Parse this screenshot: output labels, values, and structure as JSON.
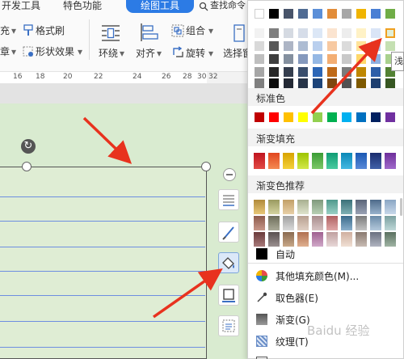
{
  "ribbon": {
    "tabs": [
      "开发工具",
      "特色功能"
    ],
    "active_tab": "绘图工具",
    "search_placeholder": "查找命令",
    "row1": {
      "fill_fragment": "充",
      "format_painter": "格式刷"
    },
    "row2": {
      "fragment": "章",
      "shape_effects": "形状效果"
    },
    "wrap": "环绕",
    "align": "对齐",
    "group": "组合",
    "rotate": "旋转",
    "select_fragment": "选择窗"
  },
  "ruler": {
    "ticks": [
      "16",
      "18",
      "20",
      "22",
      "24",
      "26",
      "28",
      "30",
      "32"
    ]
  },
  "canvas": {
    "rotate_symbol": "↻"
  },
  "dropdown": {
    "theme_colors": [
      [
        "#ffffff",
        "#000000",
        "#48546a",
        "#4f6b93",
        "#5b8fd8",
        "#e28d3a",
        "#a7a7a7",
        "#f0b400",
        "#4a7fd4",
        "#70ad47"
      ],
      [
        "#f2f2f2",
        "#7f7f7f",
        "#d5dae2",
        "#d6dde9",
        "#dce7f6",
        "#fbe4d0",
        "#ededed",
        "#fff2c6",
        "#dae5f6",
        "#e1eed6"
      ],
      [
        "#d9d9d9",
        "#595959",
        "#adb5c5",
        "#adbcd3",
        "#b9cfee",
        "#f7c9a1",
        "#dbdbdb",
        "#ffe49a",
        "#b5cbec",
        "#c5e0b2"
      ],
      [
        "#bfbfbf",
        "#3f3f3f",
        "#84909f",
        "#8599bd",
        "#95b8e4",
        "#f3ae73",
        "#c9c9c9",
        "#ffd86a",
        "#8fb1e2",
        "#a9d18e"
      ],
      [
        "#a6a6a6",
        "#262626",
        "#353e4e",
        "#3a4e6d",
        "#2c66b6",
        "#bf6a18",
        "#7b7b7b",
        "#bf8700",
        "#2d5ea8",
        "#538234"
      ],
      [
        "#808080",
        "#0d0d0d",
        "#232935",
        "#273448",
        "#1d4479",
        "#7f4710",
        "#525252",
        "#7f5a00",
        "#1e3f70",
        "#375723"
      ]
    ],
    "standard_title": "标准色",
    "standard_colors": [
      "#c00000",
      "#ff0000",
      "#ffc000",
      "#ffff00",
      "#92d050",
      "#00b050",
      "#00b0f0",
      "#0070c0",
      "#002060",
      "#7030a0"
    ],
    "gradient_title": "渐变填充",
    "gradient_colors": [
      [
        "#c0141f",
        "#e24b45"
      ],
      [
        "#e1461f",
        "#f48a52"
      ],
      [
        "#d8a300",
        "#f4d23a"
      ],
      [
        "#9ec400",
        "#d2e84a"
      ],
      [
        "#3a9c35",
        "#7dc868"
      ],
      [
        "#109c74",
        "#4bcba0"
      ],
      [
        "#0a88b7",
        "#46b8e2"
      ],
      [
        "#1a58b3",
        "#5a8ad8"
      ],
      [
        "#1a2d6e",
        "#4060a8"
      ],
      [
        "#6e2f9a",
        "#a06acb"
      ]
    ],
    "recommended_title": "渐变色推荐",
    "recommended_colors": [
      [
        [
          "#b08a3a",
          "#e8c878"
        ],
        [
          "#9a9a60",
          "#d4d4a0"
        ],
        [
          "#c2a068",
          "#e8d0a8"
        ],
        [
          "#a8b090",
          "#dfe3cc"
        ],
        [
          "#7f9a7c",
          "#b8d0b4"
        ],
        [
          "#4e9a8c",
          "#9ad0c4"
        ],
        [
          "#3a7078",
          "#80b0b4"
        ],
        [
          "#5a6478",
          "#9aa2b4"
        ],
        [
          "#4d6a8a",
          "#98b2cc"
        ],
        [
          "#8aa6c4",
          "#c8d8ea"
        ]
      ],
      [
        [
          "#8c5a4a",
          "#c8988a"
        ],
        [
          "#6e6e5a",
          "#aaaa98"
        ],
        [
          "#a0a0a0",
          "#dadada"
        ],
        [
          "#b8a090",
          "#e0d0c4"
        ],
        [
          "#a88c8c",
          "#d8c4c4"
        ],
        [
          "#b06060",
          "#e0a8a8"
        ],
        [
          "#3a6a8a",
          "#8ab0cc"
        ],
        [
          "#7a7a7a",
          "#c4c4c4"
        ],
        [
          "#6a8aa8",
          "#b4cadc"
        ],
        [
          "#7aa0a0",
          "#c0d8d8"
        ]
      ],
      [
        [
          "#6a3a3a",
          "#a87a7a"
        ],
        [
          "#5a5050",
          "#9a9090"
        ],
        [
          "#8a6a50",
          "#c8a888"
        ],
        [
          "#b07050",
          "#e0b090"
        ],
        [
          "#a06090",
          "#d0a8c8"
        ],
        [
          "#c0a0a0",
          "#e8d8d8"
        ],
        [
          "#d0b0a0",
          "#f0e0d4"
        ],
        [
          "#8a7a70",
          "#c8bcb4"
        ],
        [
          "#6a7080",
          "#b0b4c0"
        ],
        [
          "#5a7060",
          "#a0b4a4"
        ]
      ]
    ],
    "auto_label": "自动",
    "menu": [
      "其他填充颜色(M)...",
      "取色器(E)",
      "渐变(G)",
      "纹理(T)"
    ],
    "tooltip_fragment": "浅"
  },
  "watermark": "Baidu 经验"
}
